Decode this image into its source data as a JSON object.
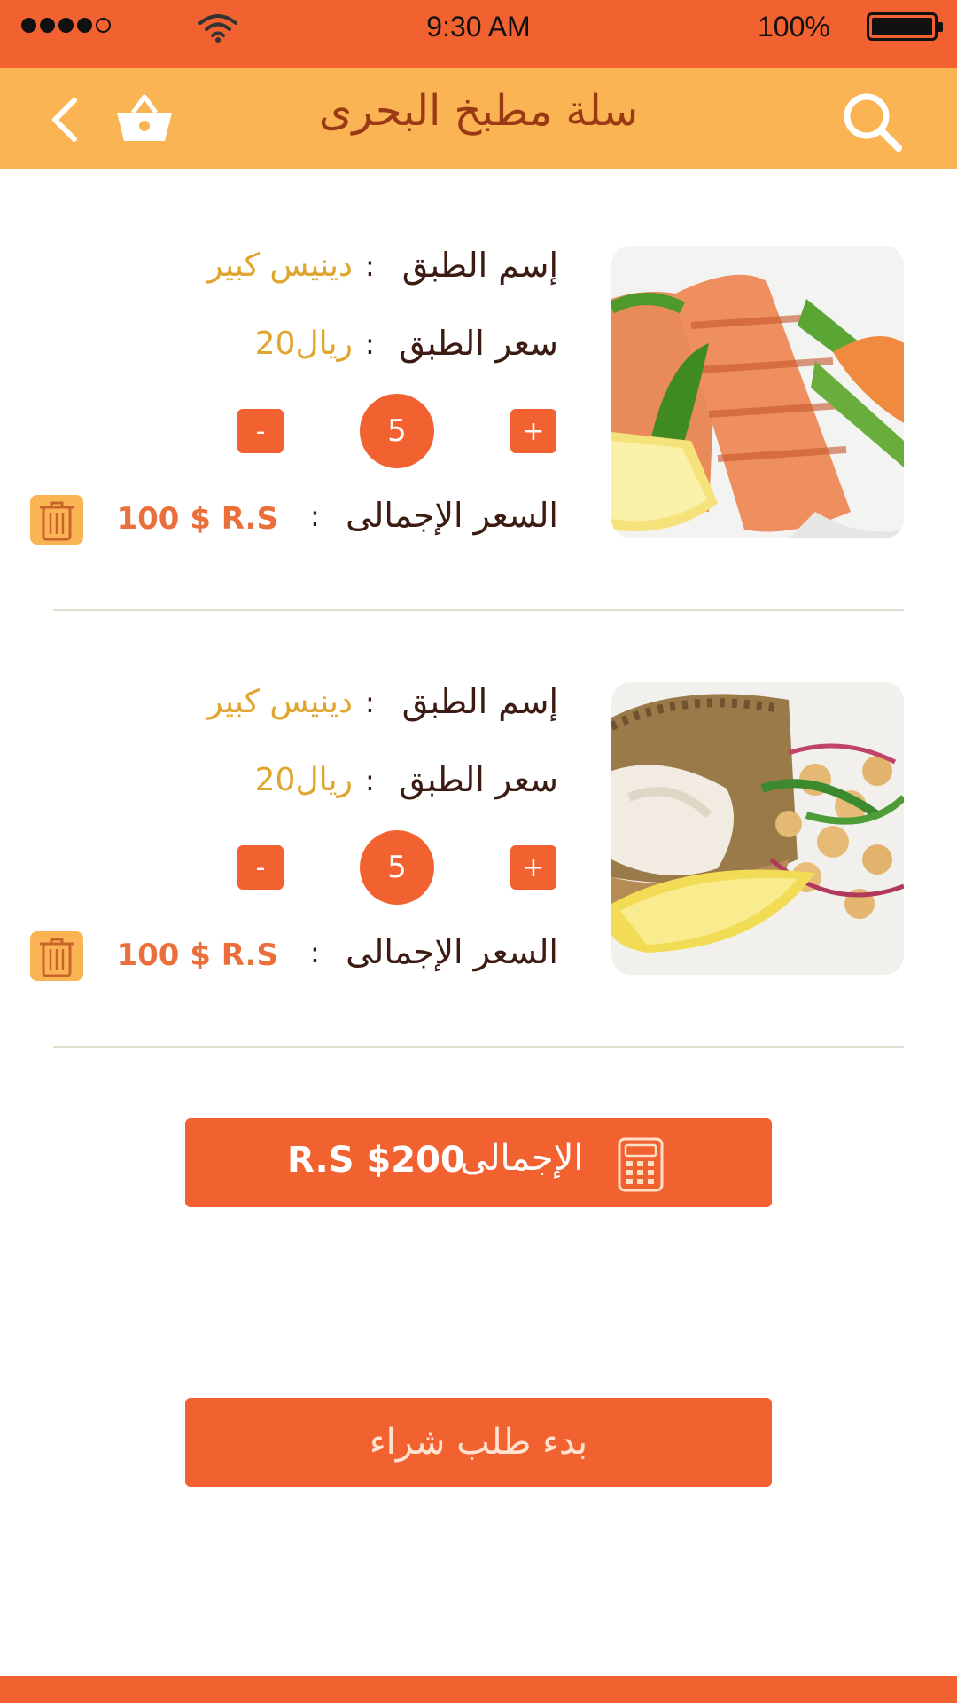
{
  "status_bar": {
    "time": "9:30 AM",
    "battery_text": "100%",
    "battery_level": 1.0,
    "signal_bars": 4,
    "signal_total": 5
  },
  "header": {
    "title": "سلة مطبخ البحرى",
    "icons": [
      "back-icon",
      "basket-icon",
      "search-icon"
    ]
  },
  "cart_items": [
    {
      "name_label": "إسم الطبق",
      "colon": ":",
      "name_value": "دينيس كبير",
      "price_label": "سعر الطبق",
      "price_value": "20ريال",
      "quantity": "5",
      "plus": "+",
      "minus": "-",
      "total_label": "السعر الإجمالى",
      "total_value": "100 $ R.S",
      "image": "grilled-salmon-photo"
    },
    {
      "name_label": "إسم الطبق",
      "colon": ":",
      "name_value": "دينيس كبير",
      "price_label": "سعر الطبق",
      "price_value": "20ريال",
      "quantity": "5",
      "plus": "+",
      "minus": "-",
      "total_label": "السعر الإجمالى",
      "total_value": "100 $ R.S",
      "image": "crusted-fish-salad-photo"
    }
  ],
  "summary": {
    "total_label": "الإجمالى",
    "total_amount": "R.S $200",
    "icon": "calculator-icon"
  },
  "order_button": "بدء طلب شراء",
  "colors": {
    "accent": "#f26130",
    "header": "#fbb454",
    "gold_text": "#e0a52f",
    "title_text": "#9a3a14"
  }
}
